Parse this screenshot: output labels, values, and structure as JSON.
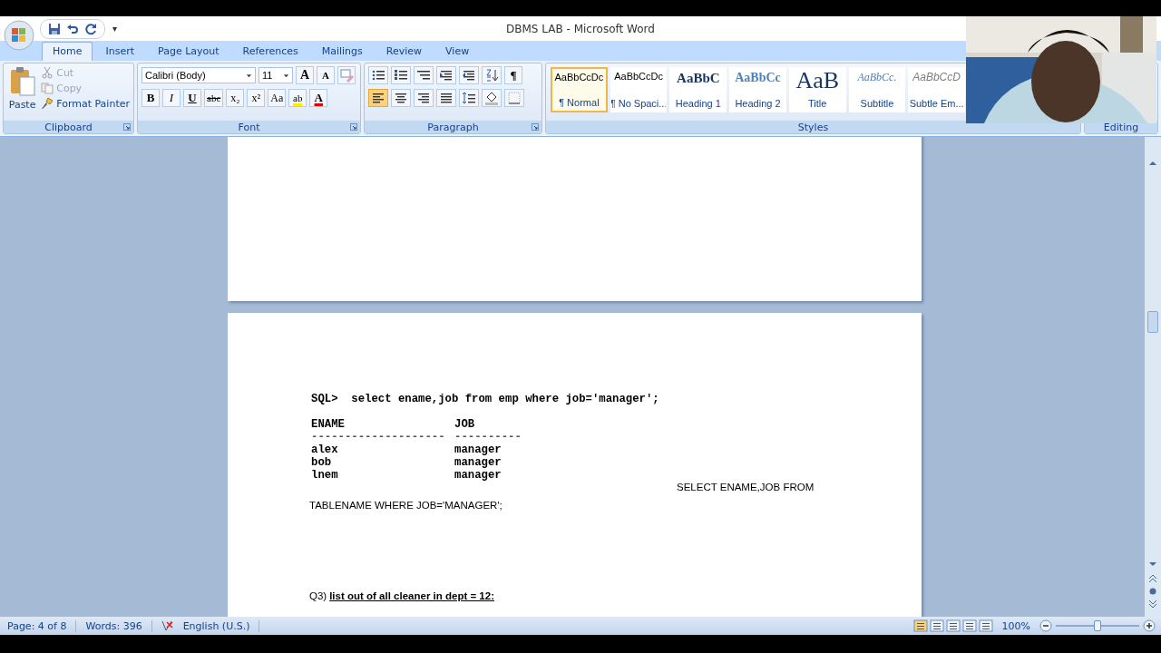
{
  "window": {
    "title": "DBMS LAB - Microsoft Word"
  },
  "quick_access": {
    "more": "▾"
  },
  "tabs": [
    {
      "label": "Home",
      "selected": true
    },
    {
      "label": "Insert",
      "selected": false
    },
    {
      "label": "Page Layout",
      "selected": false
    },
    {
      "label": "References",
      "selected": false
    },
    {
      "label": "Mailings",
      "selected": false
    },
    {
      "label": "Review",
      "selected": false
    },
    {
      "label": "View",
      "selected": false
    }
  ],
  "clipboard": {
    "paste": "Paste",
    "items": [
      {
        "kind": "cut",
        "label": "Cut",
        "disabled": true
      },
      {
        "kind": "copy",
        "label": "Copy",
        "disabled": true
      },
      {
        "kind": "painter",
        "label": "Format Painter",
        "disabled": false
      }
    ],
    "group_label": "Clipboard"
  },
  "font": {
    "font_name": "Calibri (Body)",
    "font_size": "11",
    "grow": "A",
    "shrink": "A",
    "format_buttons": [
      {
        "kind": "bold",
        "label": "B"
      },
      {
        "kind": "italic",
        "label": "I"
      },
      {
        "kind": "underline",
        "label": "U"
      },
      {
        "kind": "strike",
        "label": "abc"
      },
      {
        "kind": "sub",
        "label": "x₂"
      },
      {
        "kind": "sup",
        "label": "x²"
      },
      {
        "kind": "case",
        "label": "Aa"
      }
    ],
    "highlight": "ab",
    "font_color": "A",
    "group_label": "Font"
  },
  "paragraph": {
    "align_buttons": [
      {
        "kind": "left",
        "selected": true
      },
      {
        "kind": "center",
        "selected": false
      },
      {
        "kind": "right",
        "selected": false
      },
      {
        "kind": "justify",
        "selected": false
      }
    ],
    "show_marks": "¶",
    "group_label": "Paragraph"
  },
  "styles": {
    "items": [
      {
        "kind": "normal",
        "preview": "AaBbCcDc",
        "label": "¶ Normal",
        "selected": true
      },
      {
        "kind": "normal",
        "preview": "AaBbCcDc",
        "label": "¶ No Spaci...",
        "selected": false
      },
      {
        "kind": "heading1",
        "preview": "AaBbC",
        "label": "Heading 1",
        "selected": false
      },
      {
        "kind": "heading2",
        "preview": "AaBbCc",
        "label": "Heading 2",
        "selected": false
      },
      {
        "kind": "title",
        "preview": "AaB",
        "label": "Title",
        "selected": false
      },
      {
        "kind": "subtitle",
        "preview": "AaBbCc.",
        "label": "Subtitle",
        "selected": false
      },
      {
        "kind": "emphasis",
        "preview": "AaBbCcD",
        "label": "Subtle Em...",
        "selected": false
      }
    ],
    "group_label": "Styles"
  },
  "editing": {
    "group_label": "Editing"
  },
  "document": {
    "query": "SQL>  select ename,job from emp where job='manager';",
    "columns": [
      "ENAME",
      "JOB"
    ],
    "rules": [
      "--------------------",
      "----------"
    ],
    "rows": [
      [
        "alex",
        "manager"
      ],
      [
        "bob",
        "manager"
      ],
      [
        "lnem",
        "manager"
      ]
    ],
    "note_right": "SELECT ENAME,JOB FROM",
    "note_left": "TABLENAME WHERE JOB='MANAGER';",
    "question_number": "Q3)",
    "question": "list out of all cleaner in dept = 12:"
  },
  "status_bar": {
    "page": "Page: 4 of 8",
    "words": "Words: 396",
    "language": "English (U.S.)",
    "zoom": "100%",
    "zoom_level": {
      "level": 0.5
    }
  }
}
